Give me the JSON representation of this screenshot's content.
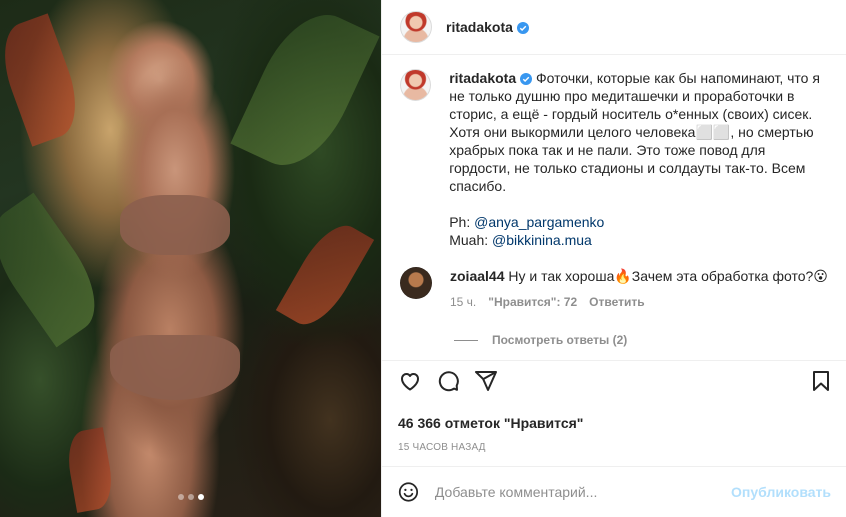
{
  "post": {
    "dots": 3,
    "active_dot": 2
  },
  "header": {
    "username": "ritadakota"
  },
  "caption": {
    "username": "ritadakota",
    "text": "Фоточки, которые как бы напоминают, что я не только душню про медиташечки и проработочки в сторис, а ещё - гордый носитель о*енных (своих) сисек. Хотя они выкормили целого человека⬜⬜, но смертью храбрых пока так и не пали. Это тоже повод для гордости, не только стадионы и солдауты так-то. Всем спасибо.",
    "photo_credit_label": "Ph: ",
    "photo_credit": "@anya_pargamenko",
    "muah_label": "Muah: ",
    "muah_credit": "@bikkinina.mua"
  },
  "comment": {
    "username": "zoiaal44",
    "text": "Ну и так хороша🔥Зачем эта обработка фото?😮",
    "time": "15 ч.",
    "likes": "\"Нравится\": 72",
    "reply": "Ответить",
    "view_replies": "Посмотреть ответы (2)"
  },
  "actions": {
    "likes": "46 366 отметок \"Нравится\"",
    "time": "15 часов назад"
  },
  "add_comment": {
    "placeholder": "Добавьте комментарий...",
    "post_label": "Опубликовать"
  },
  "colors": {
    "verified": "#3897f0",
    "link": "#00376b",
    "muted": "#8e8e8e"
  }
}
